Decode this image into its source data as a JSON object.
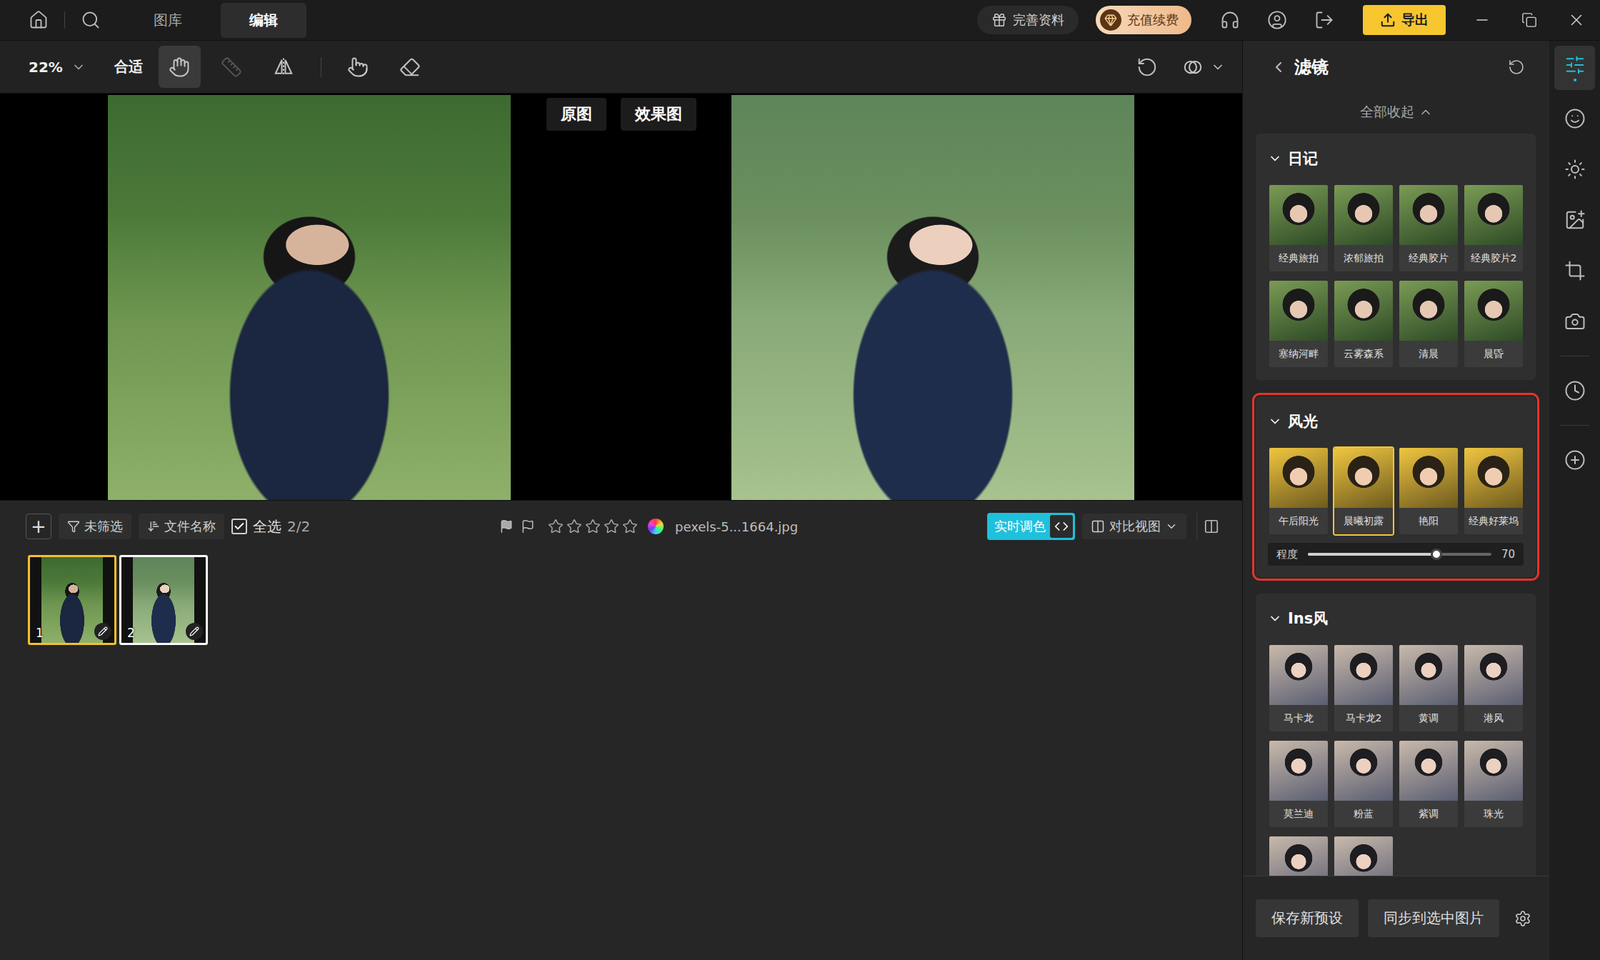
{
  "top_bar": {
    "tabs": [
      {
        "label": "图库",
        "selected": false
      },
      {
        "label": "编辑",
        "selected": true
      }
    ],
    "profile_button": "完善资料",
    "vip_button": "充值续费",
    "export_button": "导出"
  },
  "toolbar": {
    "zoom": "22%",
    "fit": "合适",
    "tool_groups": [
      [
        {
          "kind": "hand",
          "selected": true,
          "disabled": false
        },
        {
          "kind": "ruler",
          "selected": false,
          "disabled": true
        },
        {
          "kind": "flip",
          "selected": false,
          "disabled": false
        }
      ],
      [
        {
          "kind": "pointer",
          "selected": false,
          "disabled": false
        },
        {
          "kind": "eraser",
          "selected": false,
          "disabled": false
        }
      ]
    ]
  },
  "canvas": {
    "views": [
      {
        "label": "原图",
        "kind": "original"
      },
      {
        "label": "效果图",
        "kind": "effect"
      }
    ]
  },
  "bottom_bar": {
    "add": "+",
    "filter": "未筛选",
    "sort": "文件名称",
    "select_all": {
      "label": "全选",
      "checked": true,
      "count": "2/2"
    },
    "stars": 0,
    "file_name": "pexels-5...1664.jpg",
    "live_color": {
      "label": "实时调色",
      "on": true
    },
    "view_mode": "对比视图"
  },
  "thumbnails": [
    {
      "number": "1",
      "selected": true
    },
    {
      "number": "2",
      "selected": false
    }
  ],
  "filter_panel": {
    "title": "滤镜",
    "collapse_all": "全部收起",
    "sections": [
      {
        "title": "日记",
        "expanded": true,
        "highlighted": false,
        "items": [
          {
            "label": "经典旅拍",
            "selected": false
          },
          {
            "label": "浓郁旅拍",
            "selected": false
          },
          {
            "label": "经典胶片",
            "selected": false
          },
          {
            "label": "经典胶片2",
            "selected": false
          },
          {
            "label": "塞纳河畔",
            "selected": false
          },
          {
            "label": "云雾森系",
            "selected": false
          },
          {
            "label": "清晨",
            "selected": false
          },
          {
            "label": "晨昏",
            "selected": false
          }
        ]
      },
      {
        "title": "风光",
        "expanded": true,
        "highlighted": true,
        "items": [
          {
            "label": "午后阳光",
            "selected": false
          },
          {
            "label": "晨曦初露",
            "selected": true
          },
          {
            "label": "艳阳",
            "selected": false
          },
          {
            "label": "经典好莱坞",
            "selected": false
          }
        ],
        "slider": {
          "label": "程度",
          "level": 0.7,
          "reading": "70"
        }
      },
      {
        "title": "Ins风",
        "expanded": true,
        "highlighted": false,
        "items": [
          {
            "label": "马卡龙",
            "selected": false
          },
          {
            "label": "马卡龙2",
            "selected": false
          },
          {
            "label": "黄调",
            "selected": false
          },
          {
            "label": "港风",
            "selected": false
          },
          {
            "label": "莫兰迪",
            "selected": false
          },
          {
            "label": "粉蓝",
            "selected": false
          },
          {
            "label": "紫调",
            "selected": false
          },
          {
            "label": "珠光",
            "selected": false
          },
          {
            "label": "",
            "selected": false
          },
          {
            "label": "",
            "selected": false
          }
        ]
      }
    ]
  },
  "panel_buttons": [
    "保存新预设",
    "同步到选中图片"
  ],
  "side_tools": [
    [
      {
        "kind": "adjust",
        "selected": true
      },
      {
        "kind": "face",
        "selected": false
      },
      {
        "kind": "light",
        "selected": false
      },
      {
        "kind": "image",
        "selected": false
      },
      {
        "kind": "crop",
        "selected": false
      },
      {
        "kind": "camera",
        "selected": false
      }
    ],
    [
      {
        "kind": "history",
        "selected": false
      }
    ],
    [
      {
        "kind": "add",
        "selected": false
      }
    ]
  ]
}
